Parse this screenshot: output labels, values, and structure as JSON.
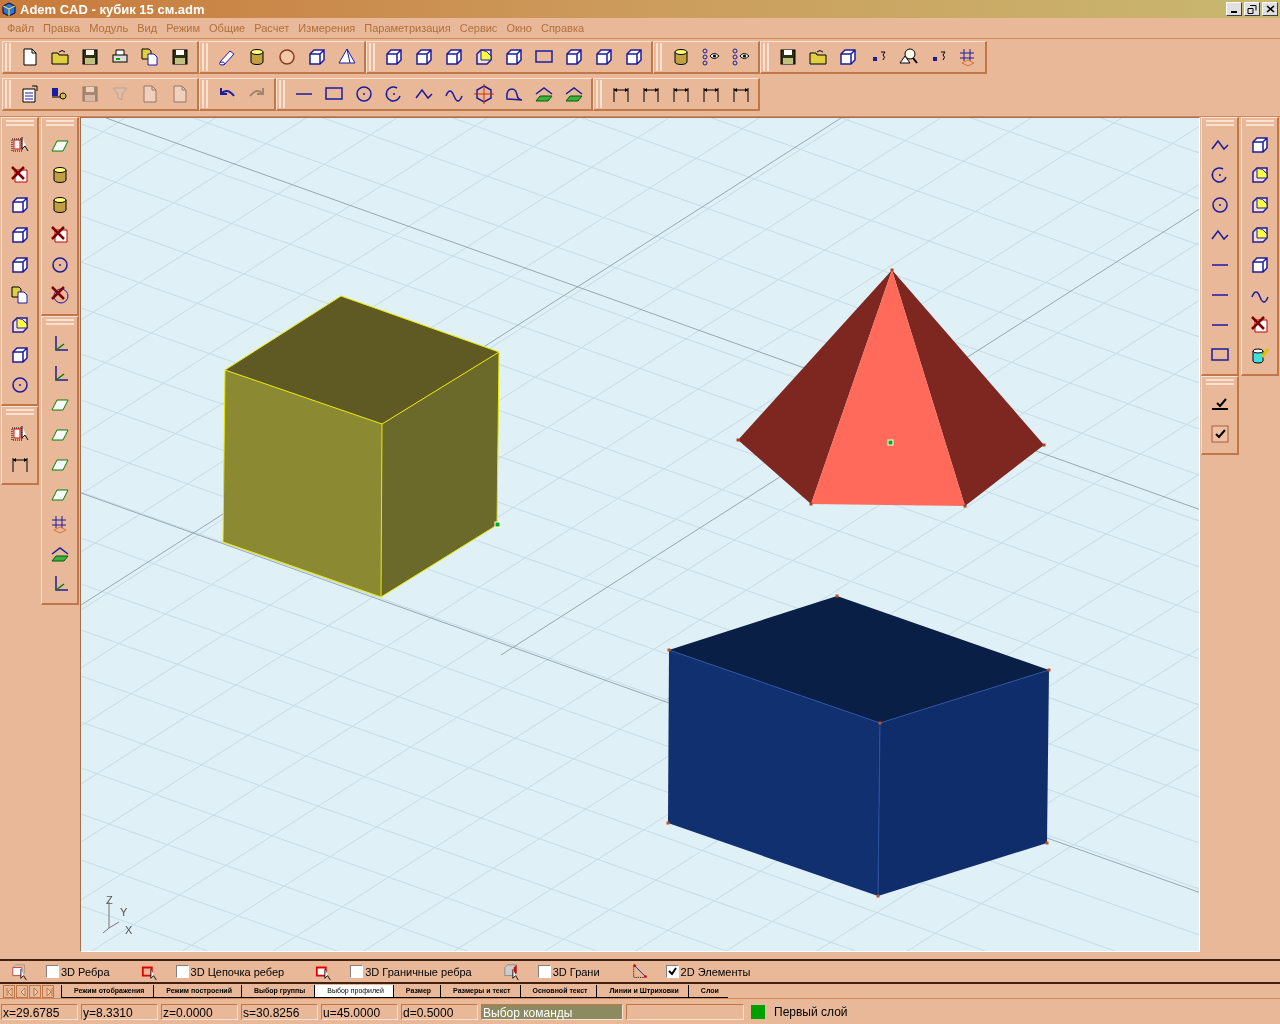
{
  "window": {
    "title": "Adem CAD - кубик 15 см.adm"
  },
  "menu": [
    "Файл",
    "Правка",
    "Модуль",
    "Вид",
    "Режим",
    "Общие",
    "Расчет",
    "Измерения",
    "Параметризация",
    "Сервис",
    "Окно",
    "Справка"
  ],
  "toolbars": [
    [
      [
        {
          "disabled": false
        },
        {
          "disabled": false
        },
        {
          "disabled": false
        },
        {
          "disabled": false
        },
        {
          "disabled": false
        },
        {
          "disabled": false
        }
      ],
      [
        {
          "disabled": false
        },
        {
          "disabled": false
        },
        {
          "disabled": false
        },
        {
          "disabled": false
        },
        {
          "disabled": false
        }
      ],
      [
        {
          "disabled": false
        },
        {
          "disabled": false
        },
        {
          "disabled": false
        },
        {
          "disabled": false
        },
        {
          "disabled": false
        },
        {
          "disabled": false
        },
        {
          "disabled": false
        },
        {
          "disabled": false
        },
        {
          "disabled": false
        }
      ],
      [
        {
          "disabled": false
        },
        {
          "disabled": false
        },
        {
          "disabled": false
        }
      ],
      [
        {
          "disabled": false
        },
        {
          "disabled": false
        },
        {
          "disabled": false
        },
        {
          "disabled": false
        },
        {
          "disabled": false
        },
        {
          "disabled": false
        },
        {
          "disabled": false
        }
      ]
    ],
    [
      [
        {
          "disabled": false
        },
        {
          "disabled": false
        },
        {
          "disabled": true
        },
        {
          "disabled": true
        },
        {
          "disabled": true
        },
        {
          "disabled": true
        }
      ],
      [
        {
          "disabled": false
        },
        {
          "disabled": true
        }
      ],
      [
        {
          "disabled": false
        },
        {
          "disabled": false
        },
        {
          "disabled": false
        },
        {
          "disabled": false
        },
        {
          "disabled": false
        },
        {
          "disabled": false
        },
        {
          "disabled": false
        },
        {
          "disabled": false
        },
        {
          "disabled": false
        },
        {
          "disabled": false
        }
      ],
      [
        {
          "disabled": false
        },
        {
          "disabled": false
        },
        {
          "disabled": false
        },
        {
          "disabled": false
        },
        {
          "disabled": false
        }
      ]
    ]
  ],
  "viewport": {
    "axes": {
      "z": "Z",
      "y": "Y",
      "x": "X"
    }
  },
  "filters": [
    {
      "label": "3D Ребра",
      "checked": false
    },
    {
      "label": "3D Цепочка ребер",
      "checked": false
    },
    {
      "label": "3D Граничные ребра",
      "checked": false
    },
    {
      "label": "3D Грани",
      "checked": false
    },
    {
      "label": "2D Элементы",
      "checked": true
    }
  ],
  "tabs": [
    {
      "label": "Режим отображения",
      "selected": false
    },
    {
      "label": "Режим построений",
      "selected": false
    },
    {
      "label": "Выбор группы",
      "selected": false
    },
    {
      "label": "Выбор профилей",
      "selected": true
    },
    {
      "label": "Размер",
      "selected": false
    },
    {
      "label": "Размеры и текст",
      "selected": false
    },
    {
      "label": "Основной текст",
      "selected": false
    },
    {
      "label": "Линии и Штриховки",
      "selected": false
    },
    {
      "label": "Слои",
      "selected": false
    }
  ],
  "status_bar": {
    "fields": [
      "x=29.6785",
      "y=8.3310",
      "z=0.0000",
      "s=30.8256",
      "u=45.0000",
      "d=0.5000"
    ],
    "command": "Выбор команды",
    "layer": {
      "name": "Первый слой",
      "color": "#00a000"
    }
  }
}
